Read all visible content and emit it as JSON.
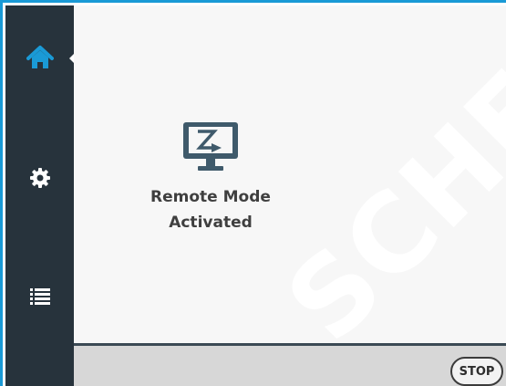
{
  "sidebar": {
    "items": [
      {
        "icon": "home-icon",
        "active": true
      },
      {
        "icon": "gear-icon",
        "active": false
      },
      {
        "icon": "list-icon",
        "active": false
      }
    ]
  },
  "main": {
    "status_icon": "remote-monitor-icon",
    "status_line1": "Remote Mode",
    "status_line2": "Activated"
  },
  "footer": {
    "stop_label": "STOP"
  },
  "watermark": {
    "text": "SCHE"
  },
  "colors": {
    "accent": "#1a9ad6",
    "sidebar_bg": "#27333c",
    "icon_slate": "#3f5a6b",
    "footer_bg": "#d7d7d7"
  }
}
